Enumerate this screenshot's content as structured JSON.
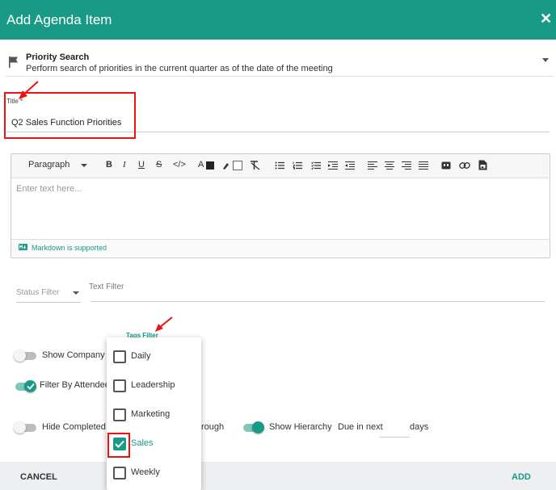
{
  "header": {
    "title": "Add Agenda Item",
    "close_glyph": "✕"
  },
  "agenda_type": {
    "name": "Priority Search",
    "description": "Perform search of priorities in the current quarter as of the date of the meeting",
    "icon": "flag-icon"
  },
  "title_field": {
    "label": "Title *",
    "value": "Q2 Sales Function Priorities"
  },
  "editor": {
    "block_format": "Paragraph",
    "placeholder": "Enter text here...",
    "markdown_note": "Markdown is supported",
    "toolbar": {
      "bold": "B",
      "italic": "I",
      "underline": "U",
      "strike": "S",
      "code": "</>",
      "font_color": "A"
    }
  },
  "filters": {
    "status_placeholder": "Status Filter",
    "text_filter_label": "Text Filter",
    "tags_label": "Tags Filter"
  },
  "options": {
    "show_company": {
      "label": "Show Company O",
      "on": false
    },
    "filter_by_attendee": {
      "label": "Filter By Attendee",
      "on": true
    },
    "hide_completed": {
      "label": "Hide Completed",
      "on": false
    },
    "through_fragment": "rough",
    "show_hierarchy": {
      "label": "Show Hierarchy",
      "on": true
    },
    "due_in_next": {
      "label": "Due in next",
      "suffix": "days",
      "value": ""
    }
  },
  "tags": [
    {
      "label": "Daily",
      "checked": false
    },
    {
      "label": "Leadership",
      "checked": false
    },
    {
      "label": "Marketing",
      "checked": false
    },
    {
      "label": "Sales",
      "checked": true
    },
    {
      "label": "Weekly",
      "checked": false
    }
  ],
  "footer": {
    "cancel": "CANCEL",
    "add": "ADD"
  },
  "colors": {
    "accent": "#199a86",
    "highlight": "#e11111"
  }
}
